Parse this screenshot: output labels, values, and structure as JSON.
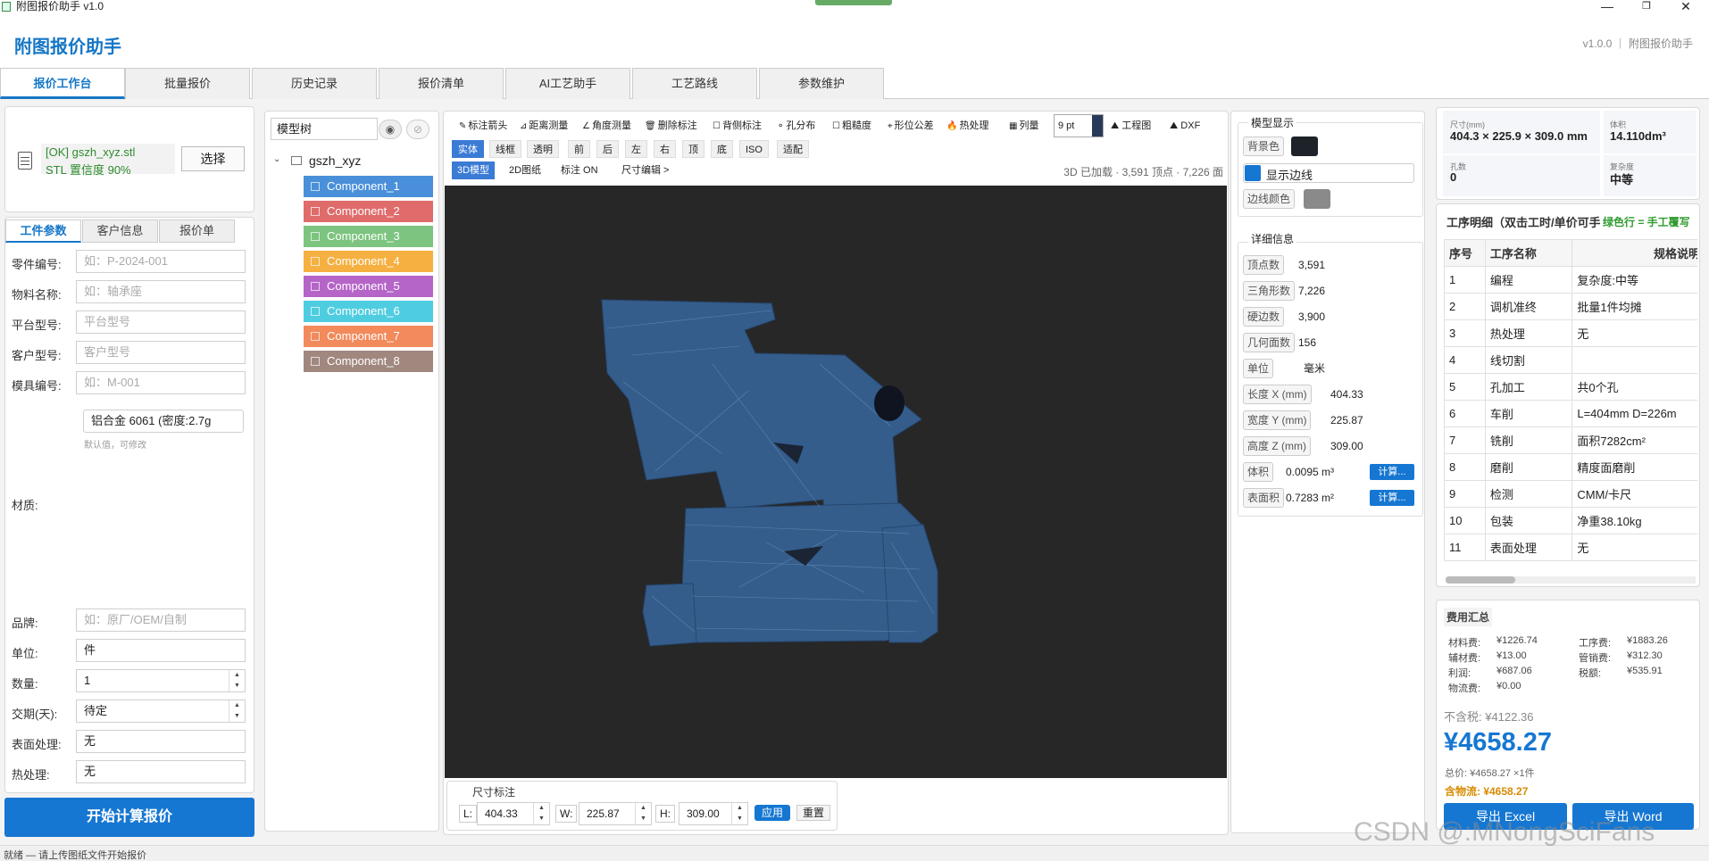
{
  "window": {
    "title": "附图报价助手 v1.0",
    "controls": [
      "—",
      "❐",
      "✕"
    ]
  },
  "header": {
    "brand": "附图报价助手",
    "version": "v1.0.0 ｜ 附图报价助手"
  },
  "tabs": [
    {
      "label": "报价工作台",
      "active": true
    },
    {
      "label": "批量报价"
    },
    {
      "label": "历史记录"
    },
    {
      "label": "报价清单"
    },
    {
      "label": "AI工艺助手"
    },
    {
      "label": "工艺路线"
    },
    {
      "label": "参数维护"
    }
  ],
  "file": {
    "status": "[OK] gszh_xyz.stl",
    "detail": "STL  置信度 90%",
    "choose": "选择"
  },
  "subtabs": [
    {
      "label": "工件参数",
      "active": true
    },
    {
      "label": "客户信息"
    },
    {
      "label": "报价单"
    }
  ],
  "form": {
    "part_no": {
      "label": "零件编号:",
      "placeholder": "如：P-2024-001"
    },
    "material_name": {
      "label": "物料名称:",
      "placeholder": "如：轴承座"
    },
    "platform": {
      "label": "平台型号:",
      "placeholder": "平台型号"
    },
    "customer_model": {
      "label": "客户型号:",
      "placeholder": "客户型号"
    },
    "mold_no": {
      "label": "模具编号:",
      "placeholder": "如：M-001"
    },
    "material": {
      "label": "材质:",
      "value": "铝合金 6061 (密度:2.7g",
      "hint": "默认值，可修改"
    },
    "brand": {
      "label": "品牌:",
      "placeholder": "如：原厂/OEM/自制"
    },
    "unit": {
      "label": "单位:",
      "value": "件"
    },
    "qty": {
      "label": "数量:",
      "value": "1"
    },
    "lead": {
      "label": "交期(天):",
      "value": "待定"
    },
    "surface": {
      "label": "表面处理:",
      "value": "无"
    },
    "heat": {
      "label": "热处理:",
      "value": "无"
    }
  },
  "start_button": "开始计算报价",
  "statusbar": "就绪 — 请上传图纸文件开始报价",
  "tree": {
    "title": "模型树",
    "root": "gszh_xyz",
    "components": [
      {
        "name": "Component_1",
        "color": "#4a8fd9"
      },
      {
        "name": "Component_2",
        "color": "#e06b6b"
      },
      {
        "name": "Component_3",
        "color": "#7cc47f"
      },
      {
        "name": "Component_4",
        "color": "#f5b041"
      },
      {
        "name": "Component_5",
        "color": "#b565c8"
      },
      {
        "name": "Component_6",
        "color": "#4fcde0"
      },
      {
        "name": "Component_7",
        "color": "#f28a5c"
      },
      {
        "name": "Component_8",
        "color": "#a1887f"
      }
    ]
  },
  "toolbar": {
    "row1": [
      "标注箭头",
      "距离测量",
      "角度测量",
      "删除标注",
      "背侧标注",
      "孔分布",
      "粗糙度",
      "形位公差",
      "热处理",
      "列量"
    ],
    "pt_value": "9 pt",
    "row1_right": [
      "工程图",
      "DXF"
    ],
    "row2": [
      "实体",
      "线框",
      "透明",
      "前",
      "后",
      "左",
      "右",
      "顶",
      "底",
      "ISO",
      "适配"
    ],
    "row3": [
      "3D模型",
      "2D图纸",
      "标注 ON",
      "尺寸编辑 >"
    ],
    "load_status": "3D 已加载 · 3,591 顶点 · 7,226 面"
  },
  "dims": {
    "title": "尺寸标注",
    "L_label": "L:",
    "L": "404.33",
    "W_label": "W:",
    "W": "225.87",
    "H_label": "H:",
    "H": "309.00",
    "apply": "应用",
    "reset": "重置"
  },
  "model_display": {
    "title": "模型显示",
    "bg_label": "背景色",
    "bg_color": "#1e2329",
    "edges_label": "显示边线",
    "edge_color_label": "边线颜色",
    "edge_color": "#8a8a8a"
  },
  "details": {
    "title": "详细信息",
    "rows": [
      {
        "k": "顶点数",
        "v": "3,591"
      },
      {
        "k": "三角形数",
        "v": "7,226"
      },
      {
        "k": "硬边数",
        "v": "3,900"
      },
      {
        "k": "几何面数",
        "v": "156"
      },
      {
        "k": "单位",
        "v": "毫米"
      },
      {
        "k": "长度 X (mm)",
        "v": "404.33"
      },
      {
        "k": "宽度 Y (mm)",
        "v": "225.87"
      },
      {
        "k": "高度 Z (mm)",
        "v": "309.00"
      },
      {
        "k": "体积",
        "v": "0.0095 m³",
        "btn": "计算..."
      },
      {
        "k": "表面积",
        "v": "0.7283 m²",
        "btn": "计算..."
      }
    ]
  },
  "summary": {
    "size_label": "尺寸(mm)",
    "size": "404.3 × 225.9 × 309.0 mm",
    "volume_label": "体积",
    "volume": "14.110dm³",
    "holes_label": "孔数",
    "holes": "0",
    "complexity_label": "复杂度",
    "complexity": "中等"
  },
  "process": {
    "title": "工序明细（双击工时/单价可手",
    "note": "绿色行 = 手工覆写",
    "headers": [
      "序号",
      "工序名称",
      "规格说明"
    ],
    "rows": [
      [
        "1",
        "编程",
        "复杂度:中等"
      ],
      [
        "2",
        "调机准终",
        "批量1件均摊"
      ],
      [
        "3",
        "热处理",
        "无"
      ],
      [
        "4",
        "线切割",
        ""
      ],
      [
        "5",
        "孔加工",
        "共0个孔"
      ],
      [
        "6",
        "车削",
        "L=404mm D=226m"
      ],
      [
        "7",
        "铣削",
        "面积7282cm²"
      ],
      [
        "8",
        "磨削",
        "精度面磨削"
      ],
      [
        "9",
        "检测",
        "CMM/卡尺"
      ],
      [
        "10",
        "包装",
        "净重38.10kg"
      ],
      [
        "11",
        "表面处理",
        "无"
      ]
    ]
  },
  "costs": {
    "title": "费用汇总",
    "items": [
      {
        "k": "材料费:",
        "v": "¥1226.74"
      },
      {
        "k": "工序费:",
        "v": "¥1883.26"
      },
      {
        "k": "辅材费:",
        "v": "¥13.00"
      },
      {
        "k": "管销费:",
        "v": "¥312.30"
      },
      {
        "k": "利润:",
        "v": "¥687.06"
      },
      {
        "k": "税额:",
        "v": "¥535.91"
      },
      {
        "k": "物流费:",
        "v": "¥0.00"
      }
    ],
    "pretax": "不含税: ¥4122.36",
    "total": "¥4658.27",
    "total_detail": "总价: ¥4658.27  ×1件",
    "with_logistics": "含物流: ¥4658.27",
    "export_excel": "导出 Excel",
    "export_word": "导出 Word"
  },
  "watermark": "CSDN @:MNongSciFans"
}
